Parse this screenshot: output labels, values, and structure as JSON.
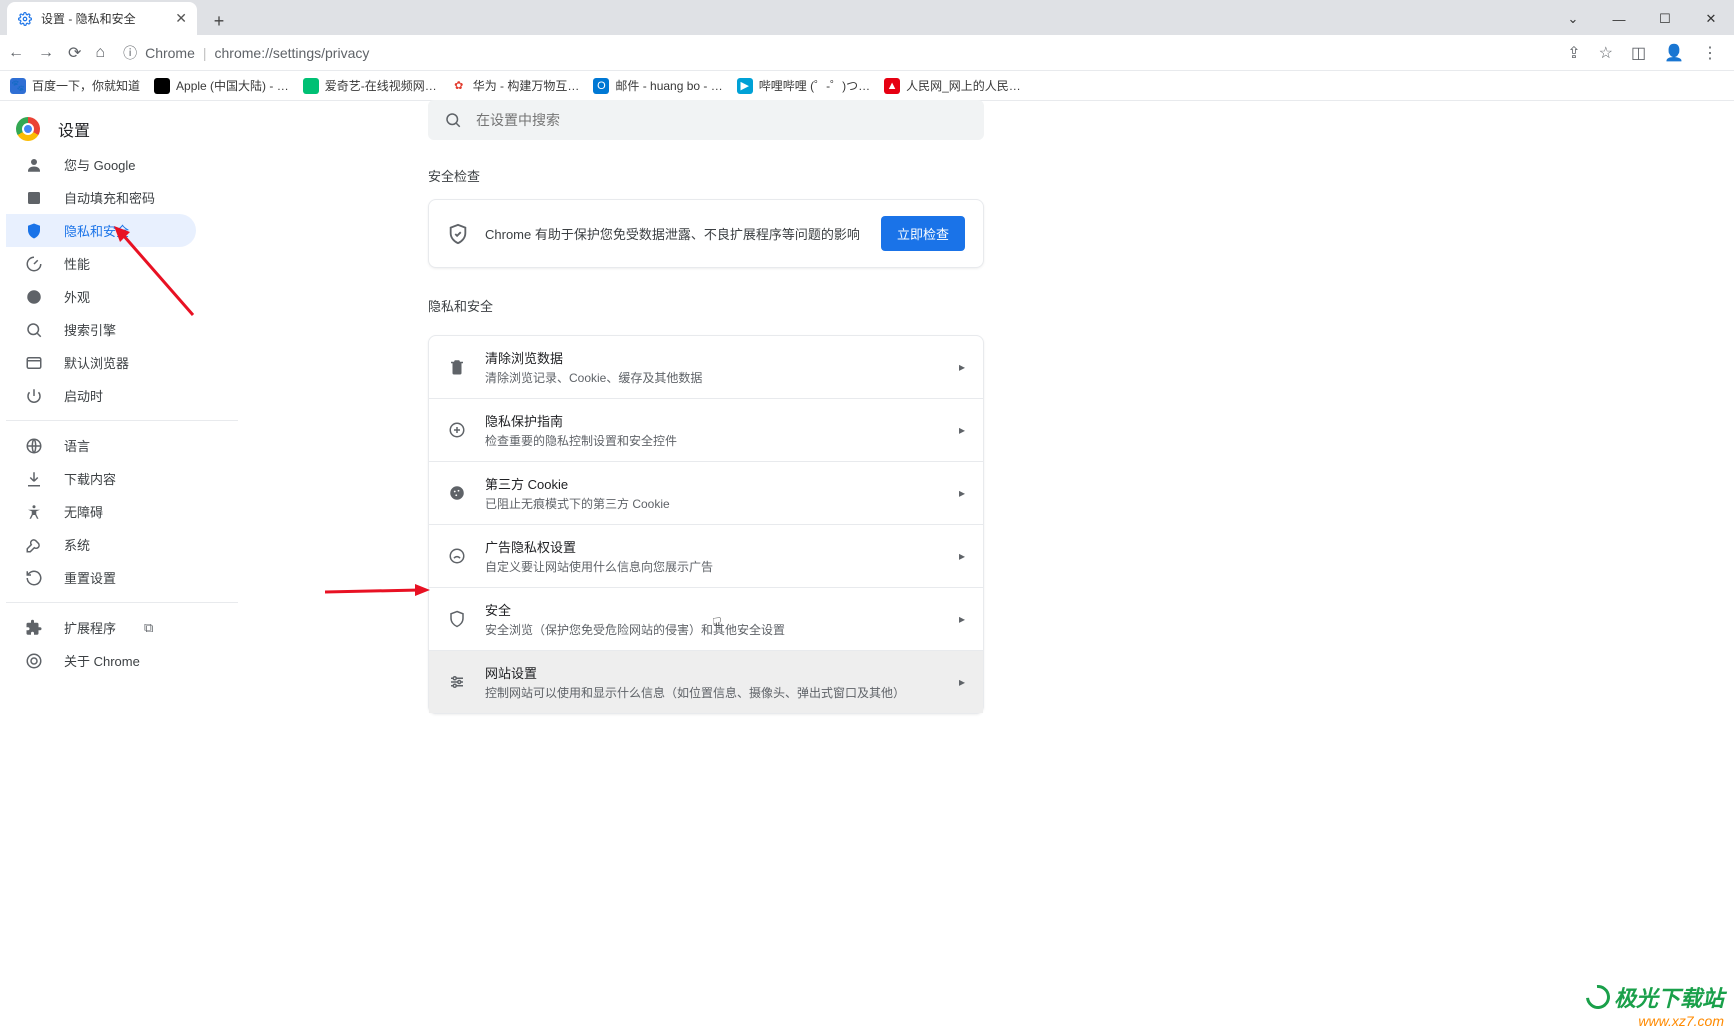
{
  "tab": {
    "title": "设置 - 隐私和安全"
  },
  "address": {
    "hostLabel": "Chrome",
    "url": "chrome://settings/privacy"
  },
  "bookmarks": [
    {
      "color": "#4a7bd4",
      "label": "百度一下，你就知道"
    },
    {
      "color": "#000",
      "label": "Apple (中国大陆) - …"
    },
    {
      "color": "#00c074",
      "label": "爱奇艺-在线视频网…"
    },
    {
      "color": "#e23b2e",
      "label": "华为 - 构建万物互…"
    },
    {
      "color": "#0060b6",
      "label": "邮件 - huang bo - …"
    },
    {
      "color": "#00a1d6",
      "label": "哔哩哔哩 (゜-゜)つ…"
    },
    {
      "color": "#e60012",
      "label": "人民网_网上的人民…"
    }
  ],
  "header": {
    "title": "设置"
  },
  "search": {
    "placeholder": "在设置中搜索"
  },
  "sidebar": {
    "items": [
      {
        "id": "you-and-google",
        "label": "您与 Google"
      },
      {
        "id": "autofill",
        "label": "自动填充和密码"
      },
      {
        "id": "privacy",
        "label": "隐私和安全"
      },
      {
        "id": "performance",
        "label": "性能"
      },
      {
        "id": "appearance",
        "label": "外观"
      },
      {
        "id": "search-engine",
        "label": "搜索引擎"
      },
      {
        "id": "default-browser",
        "label": "默认浏览器"
      },
      {
        "id": "on-startup",
        "label": "启动时"
      }
    ],
    "items2": [
      {
        "id": "language",
        "label": "语言"
      },
      {
        "id": "downloads",
        "label": "下载内容"
      },
      {
        "id": "accessibility",
        "label": "无障碍"
      },
      {
        "id": "system",
        "label": "系统"
      },
      {
        "id": "reset",
        "label": "重置设置"
      }
    ],
    "items3": [
      {
        "id": "extensions",
        "label": "扩展程序"
      },
      {
        "id": "about",
        "label": "关于 Chrome"
      }
    ]
  },
  "safety": {
    "sectionTitle": "安全检查",
    "description": "Chrome 有助于保护您免受数据泄露、不良扩展程序等问题的影响",
    "button": "立即检查"
  },
  "privacy": {
    "sectionTitle": "隐私和安全",
    "rows": [
      {
        "id": "clear-browsing",
        "title": "清除浏览数据",
        "desc": "清除浏览记录、Cookie、缓存及其他数据"
      },
      {
        "id": "privacy-guide",
        "title": "隐私保护指南",
        "desc": "检查重要的隐私控制设置和安全控件"
      },
      {
        "id": "third-party-cookie",
        "title": "第三方 Cookie",
        "desc": "已阻止无痕模式下的第三方 Cookie"
      },
      {
        "id": "ad-privacy",
        "title": "广告隐私权设置",
        "desc": "自定义要让网站使用什么信息向您展示广告"
      },
      {
        "id": "security",
        "title": "安全",
        "desc": "安全浏览（保护您免受危险网站的侵害）和其他安全设置"
      },
      {
        "id": "site-settings",
        "title": "网站设置",
        "desc": "控制网站可以使用和显示什么信息（如位置信息、摄像头、弹出式窗口及其他）"
      }
    ]
  },
  "watermark": {
    "line1": "极光下载站",
    "line2": "www.xz7.com"
  }
}
